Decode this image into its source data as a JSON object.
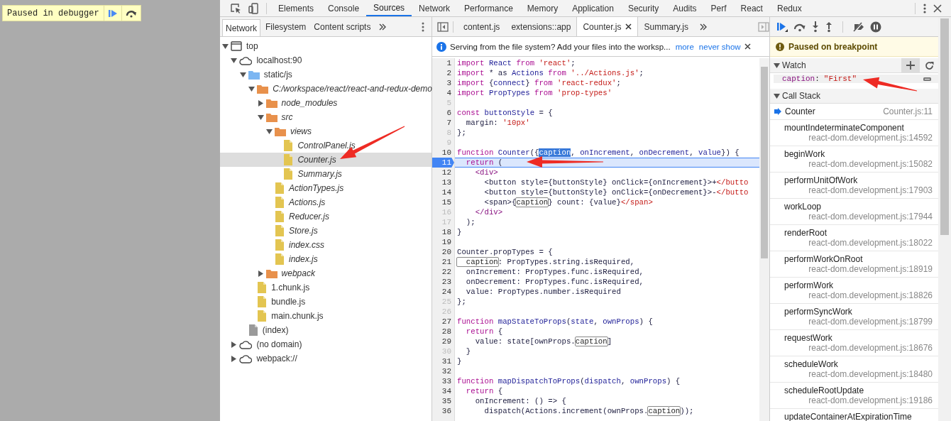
{
  "overlay": {
    "label": "Paused in debugger"
  },
  "devtools": {
    "tabs": [
      {
        "label": "Elements",
        "selected": false
      },
      {
        "label": "Console",
        "selected": false
      },
      {
        "label": "Sources",
        "selected": true
      },
      {
        "label": "Network",
        "selected": false
      },
      {
        "label": "Performance",
        "selected": false
      },
      {
        "label": "Memory",
        "selected": false
      },
      {
        "label": "Application",
        "selected": false
      },
      {
        "label": "Security",
        "selected": false
      },
      {
        "label": "Audits",
        "selected": false
      },
      {
        "label": "Perf",
        "selected": false
      },
      {
        "label": "React",
        "selected": false
      },
      {
        "label": "Redux",
        "selected": false
      }
    ]
  },
  "navigator": {
    "tabs": [
      {
        "label": "Network",
        "selected": true
      },
      {
        "label": "Filesystem",
        "selected": false
      },
      {
        "label": "Content scripts",
        "selected": false
      }
    ],
    "tree": [
      {
        "label": "top",
        "kind": "frame",
        "expanded": true,
        "selected": false,
        "children": [
          {
            "label": "localhost:90",
            "kind": "domain",
            "expanded": true,
            "selected": false,
            "children": [
              {
                "label": "static/js",
                "kind": "folder",
                "expanded": true,
                "selected": false,
                "children": [
                  {
                    "label": "C:/workspace/react/react-and-redux-demo",
                    "kind": "mapped-folder",
                    "expanded": true,
                    "selected": false,
                    "children": [
                      {
                        "label": "node_modules",
                        "kind": "mapped-folder",
                        "expanded": false,
                        "selected": false
                      },
                      {
                        "label": "src",
                        "kind": "mapped-folder",
                        "expanded": true,
                        "selected": false,
                        "children": [
                          {
                            "label": "views",
                            "kind": "mapped-folder",
                            "expanded": true,
                            "selected": false,
                            "children": [
                              {
                                "label": "ControlPanel.js",
                                "kind": "mapped-file",
                                "selected": false
                              },
                              {
                                "label": "Counter.js",
                                "kind": "mapped-file",
                                "selected": true
                              },
                              {
                                "label": "Summary.js",
                                "kind": "mapped-file",
                                "selected": false
                              }
                            ]
                          },
                          {
                            "label": "ActionTypes.js",
                            "kind": "mapped-file",
                            "selected": false
                          },
                          {
                            "label": "Actions.js",
                            "kind": "mapped-file",
                            "selected": false
                          },
                          {
                            "label": "Reducer.js",
                            "kind": "mapped-file",
                            "selected": false
                          },
                          {
                            "label": "Store.js",
                            "kind": "mapped-file",
                            "selected": false
                          },
                          {
                            "label": "index.css",
                            "kind": "mapped-file",
                            "selected": false
                          },
                          {
                            "label": "index.js",
                            "kind": "mapped-file",
                            "selected": false
                          }
                        ]
                      },
                      {
                        "label": "webpack",
                        "kind": "mapped-folder",
                        "expanded": false,
                        "selected": false
                      }
                    ]
                  },
                  {
                    "label": "1.chunk.js",
                    "kind": "file",
                    "selected": false
                  },
                  {
                    "label": "bundle.js",
                    "kind": "file",
                    "selected": false
                  },
                  {
                    "label": "main.chunk.js",
                    "kind": "file",
                    "selected": false
                  }
                ]
              },
              {
                "label": "(index)",
                "kind": "document",
                "selected": false
              }
            ]
          },
          {
            "label": "(no domain)",
            "kind": "domain",
            "expanded": false,
            "selected": false
          },
          {
            "label": "webpack://",
            "kind": "domain",
            "expanded": false,
            "selected": false
          }
        ]
      }
    ]
  },
  "editor": {
    "tabs": [
      {
        "label": "content.js",
        "selected": false
      },
      {
        "label": "extensions::app",
        "selected": false
      },
      {
        "label": "Counter.js",
        "selected": true
      },
      {
        "label": "Summary.js",
        "selected": false
      }
    ],
    "infobar": {
      "message": "Serving from the file system? Add your files into the worksp...",
      "links": [
        "more",
        "never show"
      ]
    },
    "lines": [
      {
        "number": "1",
        "muted": false,
        "current": false,
        "tokens": [
          {
            "text": "import",
            "kind": "keyword"
          },
          {
            "text": " React ",
            "kind": "name"
          },
          {
            "text": "from",
            "kind": "keyword"
          },
          {
            "text": " 'react'",
            "kind": "string"
          },
          {
            "text": ";",
            "kind": "plain"
          }
        ]
      },
      {
        "number": "2",
        "muted": false,
        "current": false,
        "tokens": [
          {
            "text": "import",
            "kind": "keyword"
          },
          {
            "text": " * as ",
            "kind": "plain"
          },
          {
            "text": "Actions ",
            "kind": "name"
          },
          {
            "text": "from",
            "kind": "keyword"
          },
          {
            "text": " '../Actions.js'",
            "kind": "string"
          },
          {
            "text": ";",
            "kind": "plain"
          }
        ]
      },
      {
        "number": "3",
        "muted": false,
        "current": false,
        "tokens": [
          {
            "text": "import",
            "kind": "keyword"
          },
          {
            "text": " {",
            "kind": "plain"
          },
          {
            "text": "connect",
            "kind": "name"
          },
          {
            "text": "} ",
            "kind": "plain"
          },
          {
            "text": "from",
            "kind": "keyword"
          },
          {
            "text": " 'react-redux'",
            "kind": "string"
          },
          {
            "text": ";",
            "kind": "plain"
          }
        ]
      },
      {
        "number": "4",
        "muted": false,
        "current": false,
        "tokens": [
          {
            "text": "import",
            "kind": "keyword"
          },
          {
            "text": " PropTypes ",
            "kind": "name"
          },
          {
            "text": "from",
            "kind": "keyword"
          },
          {
            "text": " 'prop-types'",
            "kind": "string"
          }
        ]
      },
      {
        "number": "5",
        "muted": true,
        "current": false
      },
      {
        "number": "6",
        "muted": false,
        "current": false,
        "tokens": [
          {
            "text": "const",
            "kind": "keyword"
          },
          {
            "text": " buttonStyle",
            "kind": "name"
          },
          {
            "text": " = {",
            "kind": "plain"
          }
        ]
      },
      {
        "number": "7",
        "muted": false,
        "current": false,
        "tokens": [
          {
            "text": "  margin: ",
            "kind": "plain"
          },
          {
            "text": "'10px'",
            "kind": "string"
          }
        ]
      },
      {
        "number": "8",
        "muted": true,
        "current": false,
        "tokens": [
          {
            "text": "};",
            "kind": "plain"
          }
        ]
      },
      {
        "number": "9",
        "muted": true,
        "current": false
      },
      {
        "number": "10",
        "muted": false,
        "current": false,
        "tokens": [
          {
            "text": "function",
            "kind": "keyword"
          },
          {
            "text": " Counter",
            "kind": "name"
          },
          {
            "text": "({",
            "kind": "plain"
          },
          {
            "text": "caption",
            "kind": "selection"
          },
          {
            "text": ", ",
            "kind": "plain"
          },
          {
            "text": "onIncrement",
            "kind": "name"
          },
          {
            "text": ", ",
            "kind": "plain"
          },
          {
            "text": "onDecrement",
            "kind": "name"
          },
          {
            "text": ", ",
            "kind": "plain"
          },
          {
            "text": "value",
            "kind": "name"
          },
          {
            "text": "}) {",
            "kind": "plain"
          }
        ]
      },
      {
        "number": "11",
        "muted": false,
        "current": true,
        "tokens": [
          {
            "text": "  return",
            "kind": "keyword"
          },
          {
            "text": " (",
            "kind": "plain"
          }
        ]
      },
      {
        "number": "12",
        "muted": false,
        "current": false,
        "tokens": [
          {
            "text": "    <div>",
            "kind": "tag"
          }
        ]
      },
      {
        "number": "13",
        "muted": false,
        "current": false,
        "tokens": [
          {
            "text": "      <button style={buttonStyle} onClick={onIncrement}>+",
            "kind": "plain"
          },
          {
            "text": "</butto",
            "kind": "string"
          }
        ]
      },
      {
        "number": "14",
        "muted": false,
        "current": false,
        "tokens": [
          {
            "text": "      <button style={buttonStyle} onClick={onDecrement}>-",
            "kind": "plain"
          },
          {
            "text": "</butto",
            "kind": "string"
          }
        ]
      },
      {
        "number": "15",
        "muted": false,
        "current": false,
        "tokens": [
          {
            "text": "      <span>{",
            "kind": "plain"
          },
          {
            "text": "caption",
            "kind": "match"
          },
          {
            "text": "} count: {value}",
            "kind": "plain"
          },
          {
            "text": "</span>",
            "kind": "string"
          }
        ]
      },
      {
        "number": "16",
        "muted": true,
        "current": false,
        "tokens": [
          {
            "text": "    </div>",
            "kind": "tag"
          }
        ]
      },
      {
        "number": "17",
        "muted": true,
        "current": false,
        "tokens": [
          {
            "text": "  );",
            "kind": "plain"
          }
        ]
      },
      {
        "number": "18",
        "muted": false,
        "current": false,
        "tokens": [
          {
            "text": "}",
            "kind": "plain"
          }
        ]
      },
      {
        "number": "19",
        "muted": false,
        "current": false
      },
      {
        "number": "20",
        "muted": false,
        "current": false,
        "tokens": [
          {
            "text": "Counter.propTypes = {",
            "kind": "plain"
          }
        ]
      },
      {
        "number": "21",
        "muted": false,
        "current": false,
        "tokens": [
          {
            "text": "  caption",
            "kind": "match"
          },
          {
            "text": ": PropTypes.string.isRequired,",
            "kind": "plain"
          }
        ]
      },
      {
        "number": "22",
        "muted": false,
        "current": false,
        "tokens": [
          {
            "text": "  onIncrement: PropTypes.func.isRequired,",
            "kind": "plain"
          }
        ]
      },
      {
        "number": "23",
        "muted": false,
        "current": false,
        "tokens": [
          {
            "text": "  onDecrement: PropTypes.func.isRequired,",
            "kind": "plain"
          }
        ]
      },
      {
        "number": "24",
        "muted": false,
        "current": false,
        "tokens": [
          {
            "text": "  value: PropTypes.number.isRequired",
            "kind": "plain"
          }
        ]
      },
      {
        "number": "25",
        "muted": true,
        "current": false,
        "tokens": [
          {
            "text": "};",
            "kind": "plain"
          }
        ]
      },
      {
        "number": "26",
        "muted": true,
        "current": false
      },
      {
        "number": "27",
        "muted": false,
        "current": false,
        "tokens": [
          {
            "text": "function",
            "kind": "keyword"
          },
          {
            "text": " mapStateToProps",
            "kind": "name"
          },
          {
            "text": "(",
            "kind": "plain"
          },
          {
            "text": "state",
            "kind": "name"
          },
          {
            "text": ", ",
            "kind": "plain"
          },
          {
            "text": "ownProps",
            "kind": "name"
          },
          {
            "text": ") {",
            "kind": "plain"
          }
        ]
      },
      {
        "number": "28",
        "muted": false,
        "current": false,
        "tokens": [
          {
            "text": "  return",
            "kind": "keyword"
          },
          {
            "text": " {",
            "kind": "plain"
          }
        ]
      },
      {
        "number": "29",
        "muted": false,
        "current": false,
        "tokens": [
          {
            "text": "    value: state[ownProps.",
            "kind": "plain"
          },
          {
            "text": "caption",
            "kind": "match"
          },
          {
            "text": "]",
            "kind": "plain"
          }
        ]
      },
      {
        "number": "30",
        "muted": true,
        "current": false,
        "tokens": [
          {
            "text": "  }",
            "kind": "plain"
          }
        ]
      },
      {
        "number": "31",
        "muted": false,
        "current": false,
        "tokens": [
          {
            "text": "}",
            "kind": "plain"
          }
        ]
      },
      {
        "number": "32",
        "muted": false,
        "current": false
      },
      {
        "number": "33",
        "muted": false,
        "current": false,
        "tokens": [
          {
            "text": "function",
            "kind": "keyword"
          },
          {
            "text": " mapDispatchToProps",
            "kind": "name"
          },
          {
            "text": "(",
            "kind": "plain"
          },
          {
            "text": "dispatch",
            "kind": "name"
          },
          {
            "text": ", ",
            "kind": "plain"
          },
          {
            "text": "ownProps",
            "kind": "name"
          },
          {
            "text": ") {",
            "kind": "plain"
          }
        ]
      },
      {
        "number": "34",
        "muted": false,
        "current": false,
        "tokens": [
          {
            "text": "  return",
            "kind": "keyword"
          },
          {
            "text": " {",
            "kind": "plain"
          }
        ]
      },
      {
        "number": "35",
        "muted": false,
        "current": false,
        "tokens": [
          {
            "text": "    onIncrement: () => {",
            "kind": "plain"
          }
        ]
      },
      {
        "number": "36",
        "muted": false,
        "current": false,
        "tokens": [
          {
            "text": "      dispatch(Actions.increment(ownProps.",
            "kind": "plain"
          },
          {
            "text": "caption",
            "kind": "match"
          },
          {
            "text": "));",
            "kind": "plain"
          }
        ]
      }
    ]
  },
  "debugger": {
    "banner": "Paused on breakpoint",
    "watch": {
      "title": "Watch",
      "expressions": [
        {
          "name": "caption",
          "separator": ":",
          "value": "\"First\""
        }
      ]
    },
    "call_stack": {
      "title": "Call Stack",
      "frames": [
        {
          "name": "Counter",
          "location": "Counter.js:11",
          "current": true
        },
        {
          "name": "mountIndeterminateComponent",
          "location": "react-dom.development.js:14592",
          "current": false
        },
        {
          "name": "beginWork",
          "location": "react-dom.development.js:15082",
          "current": false
        },
        {
          "name": "performUnitOfWork",
          "location": "react-dom.development.js:17903",
          "current": false
        },
        {
          "name": "workLoop",
          "location": "react-dom.development.js:17944",
          "current": false
        },
        {
          "name": "renderRoot",
          "location": "react-dom.development.js:18022",
          "current": false
        },
        {
          "name": "performWorkOnRoot",
          "location": "react-dom.development.js:18919",
          "current": false
        },
        {
          "name": "performWork",
          "location": "react-dom.development.js:18826",
          "current": false
        },
        {
          "name": "performSyncWork",
          "location": "react-dom.development.js:18799",
          "current": false
        },
        {
          "name": "requestWork",
          "location": "react-dom.development.js:18676",
          "current": false
        },
        {
          "name": "scheduleWork",
          "location": "react-dom.development.js:18480",
          "current": false
        },
        {
          "name": "scheduleRootUpdate",
          "location": "react-dom.development.js:19186",
          "current": false
        },
        {
          "name": "updateContainerAtExpirationTime",
          "current": false
        }
      ]
    }
  }
}
